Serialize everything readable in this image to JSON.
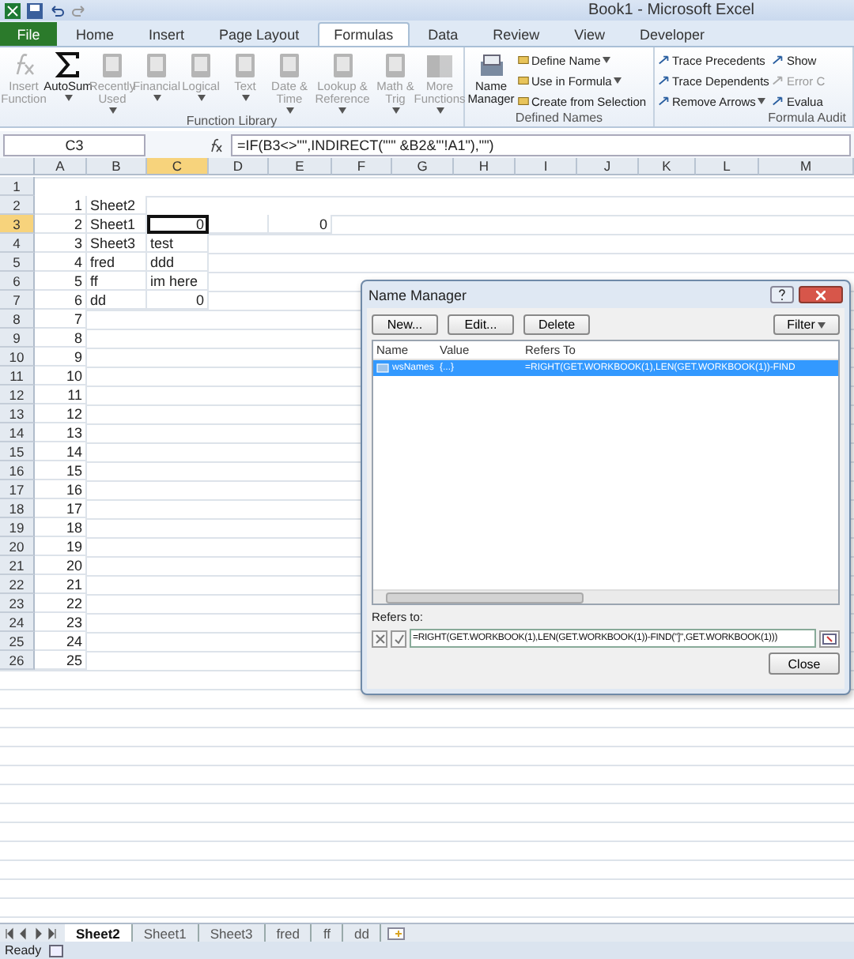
{
  "window": {
    "title": "Book1 - Microsoft Excel"
  },
  "ribbon_tabs": [
    {
      "label": "File",
      "selected": false,
      "kind": "file"
    },
    {
      "label": "Home",
      "selected": false,
      "kind": "tab"
    },
    {
      "label": "Insert",
      "selected": false,
      "kind": "tab"
    },
    {
      "label": "Page Layout",
      "selected": false,
      "kind": "tab"
    },
    {
      "label": "Formulas",
      "selected": true,
      "kind": "tab"
    },
    {
      "label": "Data",
      "selected": false,
      "kind": "tab"
    },
    {
      "label": "Review",
      "selected": false,
      "kind": "tab"
    },
    {
      "label": "View",
      "selected": false,
      "kind": "tab"
    },
    {
      "label": "Developer",
      "selected": false,
      "kind": "tab"
    }
  ],
  "function_library": {
    "label": "Function Library",
    "buttons": [
      {
        "label": "Insert Function",
        "disabled": true,
        "kind": "fx",
        "dropdown": false
      },
      {
        "label": "AutoSum",
        "disabled": false,
        "kind": "sigma",
        "dropdown": true
      },
      {
        "label": "Recently Used",
        "disabled": true,
        "kind": "book",
        "dropdown": true
      },
      {
        "label": "Financial",
        "disabled": true,
        "kind": "book",
        "dropdown": true
      },
      {
        "label": "Logical",
        "disabled": true,
        "kind": "book",
        "dropdown": true
      },
      {
        "label": "Text",
        "disabled": true,
        "kind": "book",
        "dropdown": true
      },
      {
        "label": "Date & Time",
        "disabled": true,
        "kind": "book",
        "dropdown": true
      },
      {
        "label": "Lookup & Reference",
        "disabled": true,
        "kind": "book",
        "dropdown": true
      },
      {
        "label": "Math & Trig",
        "disabled": true,
        "kind": "book",
        "dropdown": true
      },
      {
        "label": "More Functions",
        "disabled": true,
        "kind": "books",
        "dropdown": true
      }
    ]
  },
  "defined_names": {
    "label": "Defined Names",
    "large": {
      "label": "Name Manager"
    },
    "items": [
      {
        "label": "Define Name",
        "dropdown": true
      },
      {
        "label": "Use in Formula",
        "dropdown": true
      },
      {
        "label": "Create from Selection",
        "dropdown": false
      }
    ]
  },
  "formula_auditing": {
    "label": "Formula Audit",
    "items": [
      {
        "label": "Trace Precedents",
        "disabled": false,
        "dropdown": false
      },
      {
        "label": "Show",
        "disabled": false,
        "dropdown": false
      },
      {
        "label": "Trace Dependents",
        "disabled": false,
        "dropdown": false
      },
      {
        "label": "Error C",
        "disabled": true,
        "dropdown": false
      },
      {
        "label": "Remove Arrows",
        "disabled": false,
        "dropdown": true
      },
      {
        "label": "Evalua",
        "disabled": false,
        "dropdown": false
      }
    ]
  },
  "formula_bar": {
    "name_box": "C3",
    "formula": "=IF(B3<>\"\",INDIRECT(\"'\" &B2&\"'!A1\"),\"\")"
  },
  "columns": [
    {
      "label": "A",
      "selected": false
    },
    {
      "label": "B",
      "selected": false
    },
    {
      "label": "C",
      "selected": true
    },
    {
      "label": "D",
      "selected": false
    },
    {
      "label": "E",
      "selected": false
    },
    {
      "label": "F",
      "selected": false
    },
    {
      "label": "G",
      "selected": false
    },
    {
      "label": "H",
      "selected": false
    },
    {
      "label": "I",
      "selected": false
    },
    {
      "label": "J",
      "selected": false
    },
    {
      "label": "K",
      "selected": false
    },
    {
      "label": "L",
      "selected": false
    },
    {
      "label": "M",
      "selected": false
    }
  ],
  "rows": [
    {
      "header": "1",
      "selected": false,
      "cells": []
    },
    {
      "header": "2",
      "selected": false,
      "cells": [
        {
          "value": "1",
          "selected": false,
          "kind": "number"
        },
        {
          "value": "Sheet2",
          "selected": false,
          "kind": "text"
        }
      ]
    },
    {
      "header": "3",
      "selected": true,
      "cells": [
        {
          "value": "2",
          "selected": false,
          "kind": "number"
        },
        {
          "value": "Sheet1",
          "selected": false,
          "kind": "text"
        },
        {
          "value": "0",
          "selected": true,
          "kind": "number"
        },
        {
          "selected": false,
          "kind": "empty"
        },
        {
          "value": "0",
          "selected": false,
          "kind": "number"
        }
      ]
    },
    {
      "header": "4",
      "selected": false,
      "cells": [
        {
          "value": "3",
          "selected": false,
          "kind": "number"
        },
        {
          "value": "Sheet3",
          "selected": false,
          "kind": "text"
        },
        {
          "value": "test",
          "selected": false,
          "kind": "text"
        }
      ]
    },
    {
      "header": "5",
      "selected": false,
      "cells": [
        {
          "value": "4",
          "selected": false,
          "kind": "number"
        },
        {
          "value": "fred",
          "selected": false,
          "kind": "text"
        },
        {
          "value": "ddd",
          "selected": false,
          "kind": "text"
        }
      ]
    },
    {
      "header": "6",
      "selected": false,
      "cells": [
        {
          "value": "5",
          "selected": false,
          "kind": "number"
        },
        {
          "value": "ff",
          "selected": false,
          "kind": "text"
        },
        {
          "value": "im here",
          "selected": false,
          "kind": "text"
        }
      ]
    },
    {
      "header": "7",
      "selected": false,
      "cells": [
        {
          "value": "6",
          "selected": false,
          "kind": "number"
        },
        {
          "value": "dd",
          "selected": false,
          "kind": "text"
        },
        {
          "value": "0",
          "selected": false,
          "kind": "number"
        }
      ]
    },
    {
      "header": "8",
      "selected": false,
      "cells": [
        {
          "value": "7",
          "selected": false,
          "kind": "number"
        }
      ]
    },
    {
      "header": "9",
      "selected": false,
      "cells": [
        {
          "value": "8",
          "selected": false,
          "kind": "number"
        }
      ]
    },
    {
      "header": "10",
      "selected": false,
      "cells": [
        {
          "value": "9",
          "selected": false,
          "kind": "number"
        }
      ]
    },
    {
      "header": "11",
      "selected": false,
      "cells": [
        {
          "value": "10",
          "selected": false,
          "kind": "number"
        }
      ]
    },
    {
      "header": "12",
      "selected": false,
      "cells": [
        {
          "value": "11",
          "selected": false,
          "kind": "number"
        }
      ]
    },
    {
      "header": "13",
      "selected": false,
      "cells": [
        {
          "value": "12",
          "selected": false,
          "kind": "number"
        }
      ]
    },
    {
      "header": "14",
      "selected": false,
      "cells": [
        {
          "value": "13",
          "selected": false,
          "kind": "number"
        }
      ]
    },
    {
      "header": "15",
      "selected": false,
      "cells": [
        {
          "value": "14",
          "selected": false,
          "kind": "number"
        }
      ]
    },
    {
      "header": "16",
      "selected": false,
      "cells": [
        {
          "value": "15",
          "selected": false,
          "kind": "number"
        }
      ]
    },
    {
      "header": "17",
      "selected": false,
      "cells": [
        {
          "value": "16",
          "selected": false,
          "kind": "number"
        }
      ]
    },
    {
      "header": "18",
      "selected": false,
      "cells": [
        {
          "value": "17",
          "selected": false,
          "kind": "number"
        }
      ]
    },
    {
      "header": "19",
      "selected": false,
      "cells": [
        {
          "value": "18",
          "selected": false,
          "kind": "number"
        }
      ]
    },
    {
      "header": "20",
      "selected": false,
      "cells": [
        {
          "value": "19",
          "selected": false,
          "kind": "number"
        }
      ]
    },
    {
      "header": "21",
      "selected": false,
      "cells": [
        {
          "value": "20",
          "selected": false,
          "kind": "number"
        }
      ]
    },
    {
      "header": "22",
      "selected": false,
      "cells": [
        {
          "value": "21",
          "selected": false,
          "kind": "number"
        }
      ]
    },
    {
      "header": "23",
      "selected": false,
      "cells": [
        {
          "value": "22",
          "selected": false,
          "kind": "number"
        }
      ]
    },
    {
      "header": "24",
      "selected": false,
      "cells": [
        {
          "value": "23",
          "selected": false,
          "kind": "number"
        }
      ]
    },
    {
      "header": "25",
      "selected": false,
      "cells": [
        {
          "value": "24",
          "selected": false,
          "kind": "number"
        }
      ]
    },
    {
      "header": "26",
      "selected": false,
      "cells": [
        {
          "value": "25",
          "selected": false,
          "kind": "number"
        }
      ]
    }
  ],
  "name_manager": {
    "title": "Name Manager",
    "buttons": [
      {
        "label": "New...",
        "kind": "button"
      },
      {
        "label": "Edit...",
        "kind": "button"
      },
      {
        "label": "Delete",
        "kind": "button"
      },
      {
        "label": "Filter",
        "kind": "filter"
      }
    ],
    "columns": [
      "Name",
      "Value",
      "Refers To"
    ],
    "names": [
      {
        "name": "wsNames",
        "value": "{...}",
        "refers_to": "=RIGHT(GET.WORKBOOK(1),LEN(GET.WORKBOOK(1))-FIND",
        "selected": true
      }
    ],
    "refers_to_label": "Refers to:",
    "refers_to": "=RIGHT(GET.WORKBOOK(1),LEN(GET.WORKBOOK(1))-FIND(\"]\",GET.WORKBOOK(1)))",
    "close": "Close"
  },
  "sheet_tabs": [
    {
      "label": "Sheet2",
      "selected": true
    },
    {
      "label": "Sheet1",
      "selected": false
    },
    {
      "label": "Sheet3",
      "selected": false
    },
    {
      "label": "fred",
      "selected": false
    },
    {
      "label": "ff",
      "selected": false
    },
    {
      "label": "dd",
      "selected": false
    }
  ],
  "status_bar": {
    "text": "Ready"
  }
}
